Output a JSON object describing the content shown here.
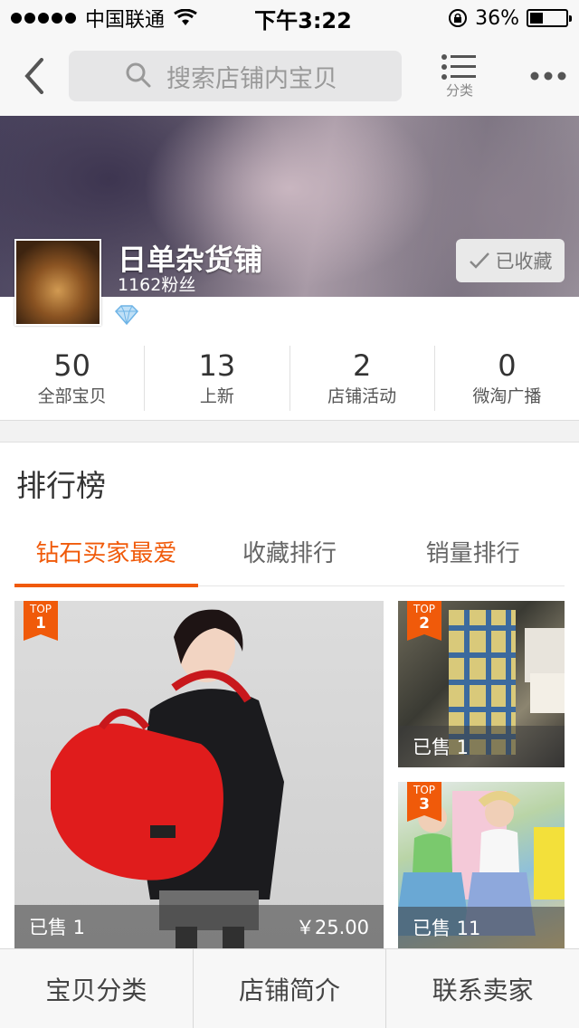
{
  "status_bar": {
    "carrier": "中国联通",
    "time": "下午3:22",
    "battery": "36%",
    "battery_level": 0.36
  },
  "nav": {
    "search_placeholder": "搜索店铺内宝贝",
    "category_label": "分类"
  },
  "shop": {
    "name": "日单杂货铺",
    "fans": "1162粉丝",
    "favorite_label": "已收藏"
  },
  "stats": [
    {
      "value": "50",
      "label": "全部宝贝"
    },
    {
      "value": "13",
      "label": "上新"
    },
    {
      "value": "2",
      "label": "店铺活动"
    },
    {
      "value": "0",
      "label": "微淘广播"
    }
  ],
  "ranking": {
    "title": "排行榜",
    "tabs": [
      "钻石买家最爱",
      "收藏排行",
      "销量排行"
    ],
    "products": [
      {
        "top_label": "TOP",
        "rank": "1",
        "sold": "已售 1",
        "price": "￥25.00"
      },
      {
        "top_label": "TOP",
        "rank": "2",
        "sold": "已售 1"
      },
      {
        "top_label": "TOP",
        "rank": "3",
        "sold": "已售 11"
      }
    ]
  },
  "bottom_bar": [
    "宝贝分类",
    "店铺简介",
    "联系卖家"
  ],
  "colors": {
    "accent": "#f05a0a"
  }
}
